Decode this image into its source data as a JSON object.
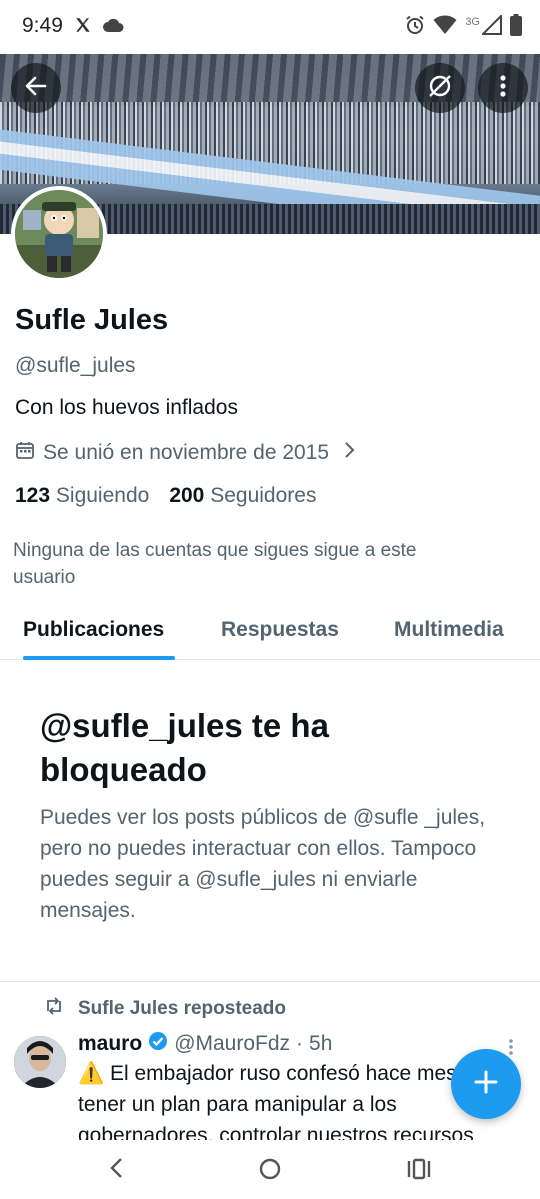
{
  "status_bar": {
    "time": "9:49",
    "network_label": "3G"
  },
  "profile": {
    "display_name": "Sufle Jules",
    "handle": "@sufle_jules",
    "bio": "Con los huevos inflados",
    "joined": "Se unió en noviembre de 2015",
    "following_count": "123",
    "following_label": "Siguiendo",
    "followers_count": "200",
    "followers_label": "Seguidores",
    "mutual_note": "Ninguna de las cuentas que sigues sigue a este usuario"
  },
  "tabs": [
    {
      "label": "Publicaciones",
      "active": true
    },
    {
      "label": "Respuestas",
      "active": false
    },
    {
      "label": "Multimedia",
      "active": false
    }
  ],
  "blocked": {
    "title": "@sufle_jules te ha bloqueado",
    "message": "Puedes ver los posts públicos de @sufle _jules, pero no puedes interactuar con ellos. Tampoco puedes seguir a @sufle_jules ni enviarle mensajes."
  },
  "post": {
    "repost_label": "Sufle Jules reposteado",
    "author_name": "mauro",
    "author_handle": "@MauroFdz",
    "separator": "·",
    "time": "5h",
    "text": "⚠️ El embajador ruso confesó hace meses tener un plan para manipular a los gobernadores, controlar nuestros recursos"
  },
  "colors": {
    "accent": "#1d9bf0",
    "text_primary": "#0f1419",
    "text_secondary": "#536471"
  },
  "icons": {
    "back": "arrow-left-icon",
    "grok": "grok-icon",
    "more": "more-vertical-icon",
    "calendar": "calendar-icon",
    "chevron": "chevron-right-icon",
    "repost": "repost-icon",
    "verified": "verified-badge-icon",
    "compose": "plus-icon"
  }
}
